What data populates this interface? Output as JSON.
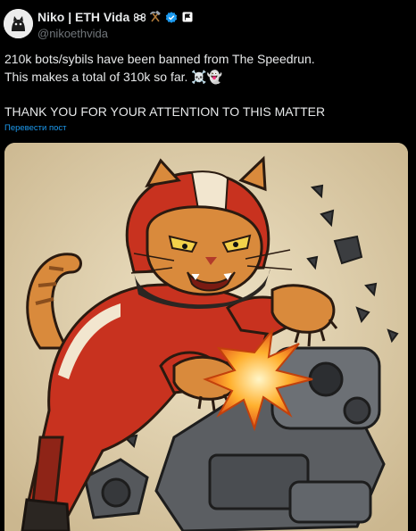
{
  "author": {
    "display_name": "Niko | ETH Vida",
    "handle": "@nikoethvida",
    "badges": [
      "command-key-icon",
      "hammer-pick-icon",
      "verified-badge-icon",
      "flag-icon"
    ]
  },
  "tweet": {
    "lines": [
      "210k bots/sybils have been banned from The Speedrun.",
      "This makes a total of 310k so far. ☠️👻",
      "THANK YOU FOR YOUR ATTENTION TO THIS MATTER"
    ],
    "translate_label": "Перевести пост"
  },
  "media": {
    "icon": "cat-racer-smashing-robot-illustration"
  },
  "colors": {
    "background": "#000000",
    "text": "#e7e9ea",
    "muted": "#71767b",
    "link": "#1d9bf0",
    "verified": "#1d9bf0"
  }
}
